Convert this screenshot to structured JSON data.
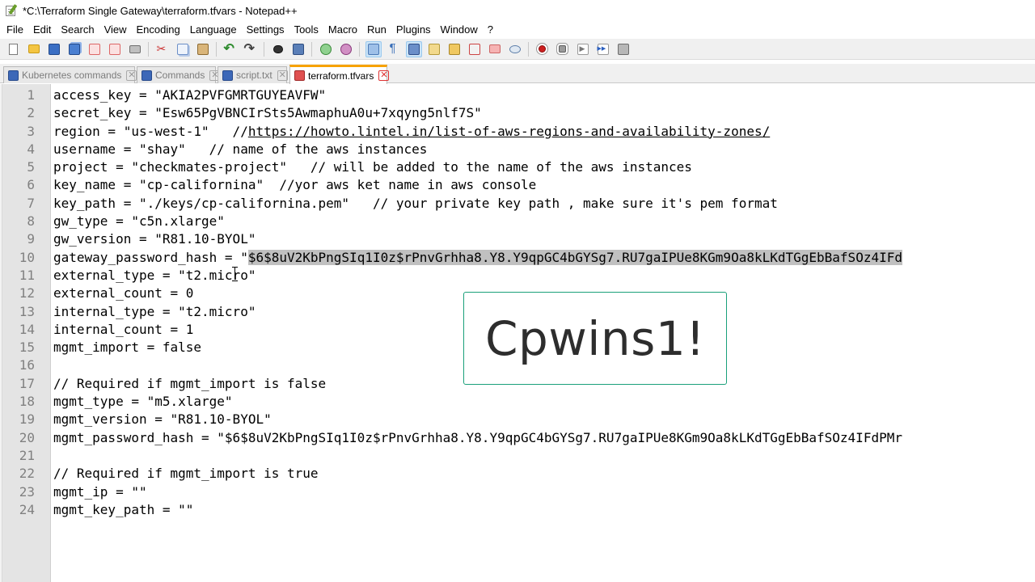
{
  "window": {
    "title": "*C:\\Terraform Single Gateway\\terraform.tfvars - Notepad++"
  },
  "menu": [
    "File",
    "Edit",
    "Search",
    "View",
    "Encoding",
    "Language",
    "Settings",
    "Tools",
    "Macro",
    "Run",
    "Plugins",
    "Window",
    "?"
  ],
  "toolbar": {
    "icons": [
      "new-file-icon",
      "open-folder-icon",
      "save-icon",
      "save-all-icon",
      "close-icon",
      "close-all-icon",
      "print-icon",
      "cut-icon",
      "copy-icon",
      "paste-icon",
      "undo-icon",
      "redo-icon",
      "find-icon",
      "replace-icon",
      "zoom-in-icon",
      "zoom-out-icon",
      "sync-scroll-icon",
      "word-wrap-icon",
      "indent-guide-icon",
      "user-language-icon",
      "document-map-icon",
      "function-list-icon",
      "folder-workspace-icon",
      "monitoring-icon",
      "record-macro-icon",
      "stop-recording-icon",
      "playback-macro-icon",
      "run-macro-multiple-icon",
      "save-macro-icon"
    ]
  },
  "tabs": [
    {
      "label": "Kubernetes commands",
      "state": "saved"
    },
    {
      "label": "Commands",
      "state": "saved"
    },
    {
      "label": "script.txt",
      "state": "saved"
    },
    {
      "label": "terraform.tfvars",
      "state": "unsaved",
      "active": true
    }
  ],
  "editor": {
    "lines": [
      {
        "n": "1",
        "text": "access_key = \"AKIA2PVFGMRTGUYEAVFW\""
      },
      {
        "n": "2",
        "text": "secret_key = \"Esw65PgVBNCIrSts5AwmaphuA0u+7xqyng5nlf7S\""
      },
      {
        "n": "3",
        "text": "region = \"us-west-1\"   //",
        "url": "https://howto.lintel.in/list-of-aws-regions-and-availability-zones/"
      },
      {
        "n": "4",
        "text": "username = \"shay\"   // name of the aws instances"
      },
      {
        "n": "5",
        "text": "project = \"checkmates-project\"   // will be added to the name of the aws instances"
      },
      {
        "n": "6",
        "text": "key_name = \"cp-californina\"  //yor aws ket name in aws console"
      },
      {
        "n": "7",
        "text": "key_path = \"./keys/cp-californina.pem\"   // your private key path , make sure it's pem format"
      },
      {
        "n": "8",
        "text": "gw_type = \"c5n.xlarge\""
      },
      {
        "n": "9",
        "text": "gw_version = \"R81.10-BYOL\""
      },
      {
        "n": "10",
        "text": "gateway_password_hash = \"",
        "selected": "$6$8uV2KbPngSIq1I0z$rPnvGrhha8.Y8.Y9qpGC4bGYSg7.RU7gaIPUe8KGm9Oa8kLKdTGgEbBafSOz4IFd"
      },
      {
        "n": "11",
        "text": "external_type = \"t2.micro\""
      },
      {
        "n": "12",
        "text": "external_count = 0"
      },
      {
        "n": "13",
        "text": "internal_type = \"t2.micro\""
      },
      {
        "n": "14",
        "text": "internal_count = 1"
      },
      {
        "n": "15",
        "text": "mgmt_import = false"
      },
      {
        "n": "16",
        "text": ""
      },
      {
        "n": "17",
        "text": "// Required if mgmt_import is false"
      },
      {
        "n": "18",
        "text": "mgmt_type = \"m5.xlarge\""
      },
      {
        "n": "19",
        "text": "mgmt_version = \"R81.10-BYOL\""
      },
      {
        "n": "20",
        "text": "mgmt_password_hash = \"$6$8uV2KbPngSIq1I0z$rPnvGrhha8.Y8.Y9qpGC4bGYSg7.RU7gaIPUe8KGm9Oa8kLKdTGgEbBafSOz4IFdPMr"
      },
      {
        "n": "21",
        "text": ""
      },
      {
        "n": "22",
        "text": "// Required if mgmt_import is true"
      },
      {
        "n": "23",
        "text": "mgmt_ip = \"\""
      },
      {
        "n": "24",
        "text": "mgmt_key_path = \"\""
      }
    ]
  },
  "overlay": {
    "text": "Cpwins1!",
    "border_color": "#1aa07a"
  },
  "colors": {
    "active_tab_accent": "#f7a200",
    "selection": "#c0c0c0",
    "gutter": "#e4e4e4"
  }
}
